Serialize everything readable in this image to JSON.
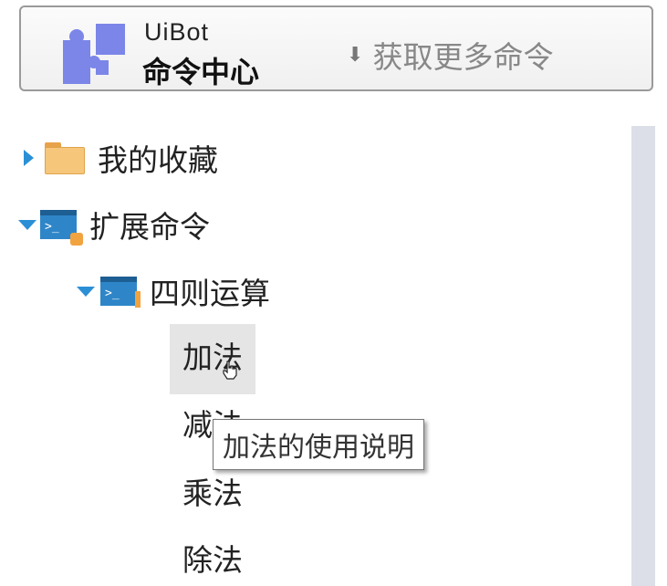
{
  "header": {
    "brand_line1": "UiBot",
    "brand_line2": "命令中心",
    "get_more_label": "获取更多命令",
    "get_more_icon": "download-arrow-icon"
  },
  "tree": {
    "favorites": {
      "label": "我的收藏",
      "expanded": false,
      "icon": "folder-icon"
    },
    "extensions": {
      "label": "扩展命令",
      "expanded": true,
      "icon": "extension-command-icon"
    },
    "arithmetic": {
      "label": "四则运算",
      "expanded": true,
      "icon": "command-window-icon"
    },
    "leaves": [
      {
        "label": "加法",
        "selected": true
      },
      {
        "label": "减法",
        "selected": false
      },
      {
        "label": "乘法",
        "selected": false
      },
      {
        "label": "除法",
        "selected": false
      }
    ]
  },
  "tooltip": {
    "text": "加法的使用说明"
  },
  "colors": {
    "caret": "#2b8fd6",
    "folder": "#f6c77b",
    "puzzle": "#7b86e8",
    "selected_bg": "#e5e5e5",
    "scroll_track": "#dcdfe8"
  }
}
